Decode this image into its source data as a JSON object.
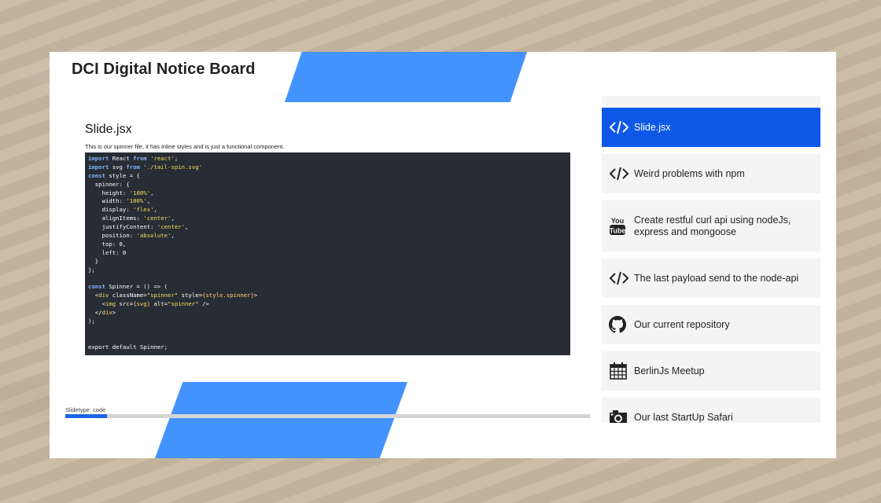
{
  "header": {
    "title": "DCI Digital Notice Board"
  },
  "slide": {
    "title": "Slide.jsx",
    "description": "This is our spinner file, it has inline styles and is just a functional component.",
    "type_label": "Slidetype: code",
    "progress": 0.08
  },
  "code_lines": [
    [
      [
        "kw",
        "import"
      ],
      [
        "t",
        " React "
      ],
      [
        "kw",
        "from"
      ],
      [
        "t",
        " "
      ],
      [
        "str",
        "'react'"
      ],
      [
        "t",
        ";"
      ]
    ],
    [
      [
        "kw",
        "import"
      ],
      [
        "t",
        " svg "
      ],
      [
        "kw",
        "from"
      ],
      [
        "t",
        " "
      ],
      [
        "str",
        "'./tail-spin.svg'"
      ]
    ],
    [
      [
        "kw",
        "const"
      ],
      [
        "t",
        " style = {"
      ]
    ],
    [
      [
        "t",
        "  spinner: {"
      ]
    ],
    [
      [
        "t",
        "    height: "
      ],
      [
        "str",
        "'100%'"
      ],
      [
        "t",
        ","
      ]
    ],
    [
      [
        "t",
        "    width: "
      ],
      [
        "str",
        "'100%'"
      ],
      [
        "t",
        ","
      ]
    ],
    [
      [
        "t",
        "    display: "
      ],
      [
        "str",
        "'flex'"
      ],
      [
        "t",
        ","
      ]
    ],
    [
      [
        "t",
        "    alignItems: "
      ],
      [
        "str",
        "'center'"
      ],
      [
        "t",
        ","
      ]
    ],
    [
      [
        "t",
        "    justifyContent: "
      ],
      [
        "str",
        "'center'"
      ],
      [
        "t",
        ","
      ]
    ],
    [
      [
        "t",
        "    position: "
      ],
      [
        "str",
        "'absolute'"
      ],
      [
        "t",
        ","
      ]
    ],
    [
      [
        "t",
        "    top: 0,"
      ]
    ],
    [
      [
        "t",
        "    left: 0"
      ]
    ],
    [
      [
        "t",
        "  }"
      ]
    ],
    [
      [
        "t",
        "};"
      ]
    ],
    [
      [
        "t",
        ""
      ]
    ],
    [
      [
        "kw",
        "const"
      ],
      [
        "t",
        " Spinner = () => ("
      ]
    ],
    [
      [
        "t",
        "  <"
      ],
      [
        "tag",
        "div"
      ],
      [
        "t",
        " className="
      ],
      [
        "str",
        "\"spinner\""
      ],
      [
        "t",
        " style="
      ],
      [
        "att",
        "{style.spinner}"
      ],
      [
        "t",
        ">"
      ]
    ],
    [
      [
        "t",
        "    <"
      ],
      [
        "tag",
        "img"
      ],
      [
        "t",
        " src="
      ],
      [
        "att",
        "{svg}"
      ],
      [
        "t",
        " alt="
      ],
      [
        "str",
        "\"spinner\""
      ],
      [
        "t",
        " />"
      ]
    ],
    [
      [
        "t",
        "  </"
      ],
      [
        "tag",
        "div"
      ],
      [
        "t",
        ">"
      ]
    ],
    [
      [
        "t",
        ");"
      ]
    ],
    [
      [
        "t",
        ""
      ]
    ],
    [
      [
        "t",
        ""
      ]
    ],
    [
      [
        "t",
        "export default Spinner;"
      ]
    ]
  ],
  "sidebar": {
    "items": [
      {
        "label": "Slide.jsx",
        "icon": "code-icon",
        "active": true
      },
      {
        "label": "Weird problems with npm",
        "icon": "code-icon",
        "active": false
      },
      {
        "label": "Create restful curl api using nodeJs, express and mongoose",
        "icon": "youtube-icon",
        "active": false
      },
      {
        "label": "The last payload send to the node-api",
        "icon": "code-icon",
        "active": false
      },
      {
        "label": "Our current repository",
        "icon": "github-icon",
        "active": false
      },
      {
        "label": "BerlinJs Meetup",
        "icon": "calendar-icon",
        "active": false
      },
      {
        "label": "Our last StartUp Safari",
        "icon": "camera-icon",
        "active": false
      }
    ]
  },
  "colors": {
    "accent": "#4393ff",
    "active": "#0e58e8",
    "code_bg": "#282c34"
  }
}
